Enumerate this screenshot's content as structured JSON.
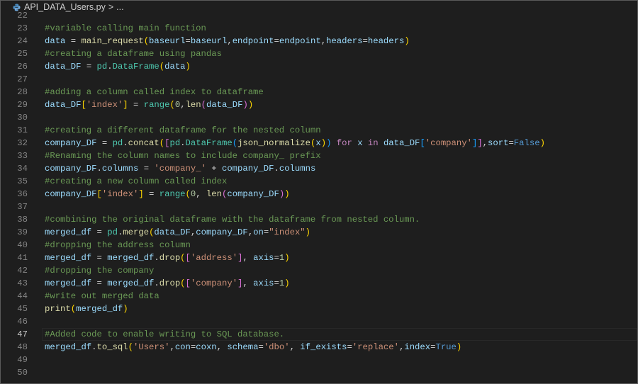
{
  "breadcrumb": {
    "file": "API_DATA_Users.py",
    "separator": ">",
    "more": "...",
    "icon": "python-file-icon"
  },
  "colors": {
    "background": "#1e1e1e",
    "comment": "#6a9955",
    "variable": "#9cdcfe",
    "function": "#dcdcaa",
    "class": "#4ec9b0",
    "string": "#ce9178",
    "keyword": "#c586c0",
    "bool": "#569cd6"
  },
  "editor": {
    "active_line": 47,
    "lines": [
      {
        "n": 22,
        "t": []
      },
      {
        "n": 23,
        "t": [
          [
            "#variable calling main function",
            "m"
          ]
        ]
      },
      {
        "n": 24,
        "t": [
          [
            "data",
            "v"
          ],
          [
            " = ",
            "o"
          ],
          [
            "main_request",
            "f"
          ],
          [
            "(",
            "b1"
          ],
          [
            "baseurl",
            "v"
          ],
          [
            "=",
            "o"
          ],
          [
            "baseurl",
            "v"
          ],
          [
            ",",
            "o"
          ],
          [
            "endpoint",
            "v"
          ],
          [
            "=",
            "o"
          ],
          [
            "endpoint",
            "v"
          ],
          [
            ",",
            "o"
          ],
          [
            "headers",
            "v"
          ],
          [
            "=",
            "o"
          ],
          [
            "headers",
            "v"
          ],
          [
            ")",
            "b1"
          ]
        ]
      },
      {
        "n": 25,
        "t": [
          [
            "#creating a dataframe using pandas",
            "m"
          ]
        ]
      },
      {
        "n": 26,
        "t": [
          [
            "data_DF",
            "v"
          ],
          [
            " = ",
            "o"
          ],
          [
            "pd",
            "c"
          ],
          [
            ".",
            "o"
          ],
          [
            "DataFrame",
            "c"
          ],
          [
            "(",
            "b1"
          ],
          [
            "data",
            "v"
          ],
          [
            ")",
            "b1"
          ]
        ]
      },
      {
        "n": 27,
        "t": []
      },
      {
        "n": 28,
        "t": [
          [
            "#adding a column called index to dataframe",
            "m"
          ]
        ]
      },
      {
        "n": 29,
        "t": [
          [
            "data_DF",
            "v"
          ],
          [
            "[",
            "b1"
          ],
          [
            "'index'",
            "s"
          ],
          [
            "]",
            "b1"
          ],
          [
            " = ",
            "o"
          ],
          [
            "range",
            "c"
          ],
          [
            "(",
            "b1"
          ],
          [
            "0",
            "n"
          ],
          [
            ",",
            "o"
          ],
          [
            "len",
            "f"
          ],
          [
            "(",
            "b2"
          ],
          [
            "data_DF",
            "v"
          ],
          [
            ")",
            "b2"
          ],
          [
            ")",
            "b1"
          ]
        ]
      },
      {
        "n": 30,
        "t": []
      },
      {
        "n": 31,
        "t": [
          [
            "#creating a different dataframe for the nested column",
            "m"
          ]
        ]
      },
      {
        "n": 32,
        "t": [
          [
            "company_DF",
            "v"
          ],
          [
            " = ",
            "o"
          ],
          [
            "pd",
            "c"
          ],
          [
            ".",
            "o"
          ],
          [
            "concat",
            "f"
          ],
          [
            "(",
            "b1"
          ],
          [
            "[",
            "b2"
          ],
          [
            "pd",
            "c"
          ],
          [
            ".",
            "o"
          ],
          [
            "DataFrame",
            "c"
          ],
          [
            "(",
            "b3"
          ],
          [
            "json_normalize",
            "f"
          ],
          [
            "(",
            "b1"
          ],
          [
            "x",
            "v"
          ],
          [
            ")",
            "b1"
          ],
          [
            ")",
            "b3"
          ],
          [
            " for ",
            "k"
          ],
          [
            "x",
            "v"
          ],
          [
            " in ",
            "k"
          ],
          [
            "data_DF",
            "v"
          ],
          [
            "[",
            "b3"
          ],
          [
            "'company'",
            "s"
          ],
          [
            "]",
            "b3"
          ],
          [
            "]",
            "b2"
          ],
          [
            ",",
            "o"
          ],
          [
            "sort",
            "v"
          ],
          [
            "=",
            "o"
          ],
          [
            "False",
            "t"
          ],
          [
            ")",
            "b1"
          ]
        ]
      },
      {
        "n": 33,
        "t": [
          [
            "#Renaming the column names to include company_ prefix",
            "m"
          ]
        ]
      },
      {
        "n": 34,
        "t": [
          [
            "company_DF",
            "v"
          ],
          [
            ".",
            "o"
          ],
          [
            "columns",
            "v"
          ],
          [
            " = ",
            "o"
          ],
          [
            "'company_'",
            "s"
          ],
          [
            " + ",
            "o"
          ],
          [
            "company_DF",
            "v"
          ],
          [
            ".",
            "o"
          ],
          [
            "columns",
            "v"
          ]
        ]
      },
      {
        "n": 35,
        "t": [
          [
            "#creating a new column called index",
            "m"
          ]
        ]
      },
      {
        "n": 36,
        "t": [
          [
            "company_DF",
            "v"
          ],
          [
            "[",
            "b1"
          ],
          [
            "'index'",
            "s"
          ],
          [
            "]",
            "b1"
          ],
          [
            " = ",
            "o"
          ],
          [
            "range",
            "c"
          ],
          [
            "(",
            "b1"
          ],
          [
            "0",
            "n"
          ],
          [
            ", ",
            "o"
          ],
          [
            "len",
            "f"
          ],
          [
            "(",
            "b2"
          ],
          [
            "company_DF",
            "v"
          ],
          [
            ")",
            "b2"
          ],
          [
            ")",
            "b1"
          ]
        ]
      },
      {
        "n": 37,
        "t": []
      },
      {
        "n": 38,
        "t": [
          [
            "#combining the original dataframe with the dataframe from nested column.",
            "m"
          ]
        ]
      },
      {
        "n": 39,
        "t": [
          [
            "merged_df",
            "v"
          ],
          [
            " = ",
            "o"
          ],
          [
            "pd",
            "c"
          ],
          [
            ".",
            "o"
          ],
          [
            "merge",
            "f"
          ],
          [
            "(",
            "b1"
          ],
          [
            "data_DF",
            "v"
          ],
          [
            ",",
            "o"
          ],
          [
            "company_DF",
            "v"
          ],
          [
            ",",
            "o"
          ],
          [
            "on",
            "v"
          ],
          [
            "=",
            "o"
          ],
          [
            "\"index\"",
            "s"
          ],
          [
            ")",
            "b1"
          ]
        ]
      },
      {
        "n": 40,
        "t": [
          [
            "#dropping the address column",
            "m"
          ]
        ]
      },
      {
        "n": 41,
        "t": [
          [
            "merged_df",
            "v"
          ],
          [
            " = ",
            "o"
          ],
          [
            "merged_df",
            "v"
          ],
          [
            ".",
            "o"
          ],
          [
            "drop",
            "f"
          ],
          [
            "(",
            "b1"
          ],
          [
            "[",
            "b2"
          ],
          [
            "'address'",
            "s"
          ],
          [
            "]",
            "b2"
          ],
          [
            ", ",
            "o"
          ],
          [
            "axis",
            "v"
          ],
          [
            "=",
            "o"
          ],
          [
            "1",
            "n"
          ],
          [
            ")",
            "b1"
          ]
        ]
      },
      {
        "n": 42,
        "t": [
          [
            "#dropping the company",
            "m"
          ]
        ]
      },
      {
        "n": 43,
        "t": [
          [
            "merged_df",
            "v"
          ],
          [
            " = ",
            "o"
          ],
          [
            "merged_df",
            "v"
          ],
          [
            ".",
            "o"
          ],
          [
            "drop",
            "f"
          ],
          [
            "(",
            "b1"
          ],
          [
            "[",
            "b2"
          ],
          [
            "'company'",
            "s"
          ],
          [
            "]",
            "b2"
          ],
          [
            ", ",
            "o"
          ],
          [
            "axis",
            "v"
          ],
          [
            "=",
            "o"
          ],
          [
            "1",
            "n"
          ],
          [
            ")",
            "b1"
          ]
        ]
      },
      {
        "n": 44,
        "t": [
          [
            "#write out merged data",
            "m"
          ]
        ]
      },
      {
        "n": 45,
        "t": [
          [
            "print",
            "f"
          ],
          [
            "(",
            "b1"
          ],
          [
            "merged_df",
            "v"
          ],
          [
            ")",
            "b1"
          ]
        ]
      },
      {
        "n": 46,
        "t": []
      },
      {
        "n": 47,
        "t": [
          [
            "#Added code to enable writing to SQL database.",
            "m"
          ]
        ]
      },
      {
        "n": 48,
        "t": [
          [
            "merged_df",
            "v"
          ],
          [
            ".",
            "o"
          ],
          [
            "to_sql",
            "f"
          ],
          [
            "(",
            "b1"
          ],
          [
            "'Users'",
            "s"
          ],
          [
            ",",
            "o"
          ],
          [
            "con",
            "v"
          ],
          [
            "=",
            "o"
          ],
          [
            "coxn",
            "v"
          ],
          [
            ", ",
            "o"
          ],
          [
            "schema",
            "v"
          ],
          [
            "=",
            "o"
          ],
          [
            "'dbo'",
            "s"
          ],
          [
            ", ",
            "o"
          ],
          [
            "if_exists",
            "v"
          ],
          [
            "=",
            "o"
          ],
          [
            "'replace'",
            "s"
          ],
          [
            ",",
            "o"
          ],
          [
            "index",
            "v"
          ],
          [
            "=",
            "o"
          ],
          [
            "True",
            "t"
          ],
          [
            ")",
            "b1"
          ]
        ]
      },
      {
        "n": 49,
        "t": []
      },
      {
        "n": 50,
        "t": []
      }
    ]
  }
}
